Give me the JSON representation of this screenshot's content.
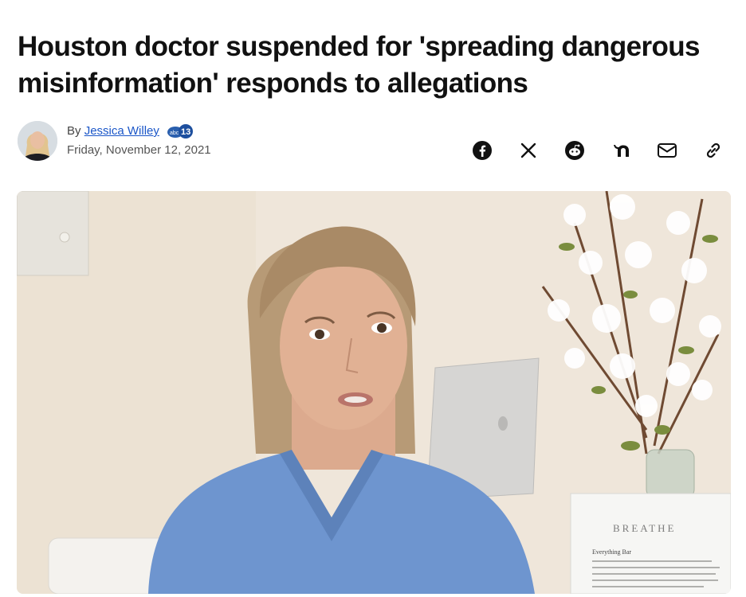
{
  "article": {
    "headline": "Houston doctor suspended for 'spreading dangerous misinformation' responds to allegations",
    "byline_prefix": "By",
    "author": "Jessica Willey",
    "station": "abc13",
    "date": "Friday, November 12, 2021"
  },
  "share": {
    "icons": [
      "facebook-icon",
      "x-icon",
      "reddit-icon",
      "nextdoor-icon",
      "email-icon",
      "link-icon"
    ]
  },
  "media": {
    "brochure_title": "BREATHE",
    "brochure_subtitle": "Everything Bar"
  },
  "colors": {
    "author_link": "#1a56c8",
    "scrubs": "#6e95cf",
    "wall": "#efe6da"
  }
}
